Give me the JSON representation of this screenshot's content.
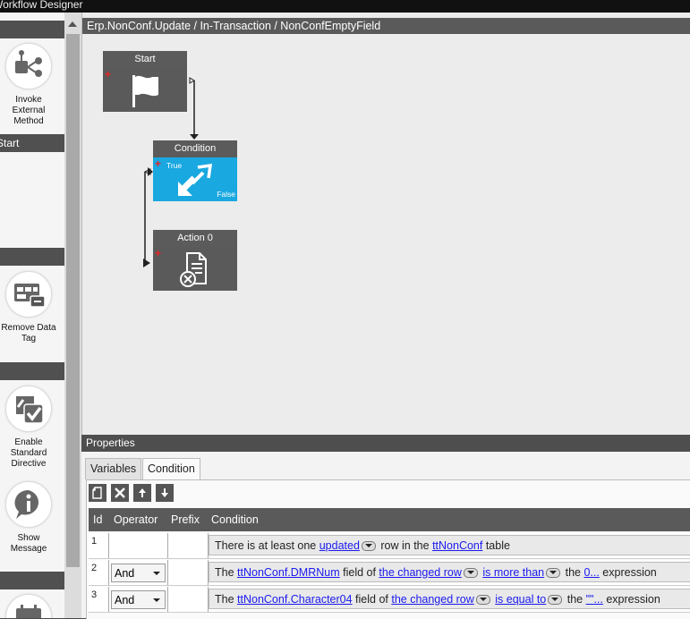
{
  "window": {
    "title": "Workflow Designer"
  },
  "toolbox": {
    "headers": [
      "",
      "Start",
      "",
      ""
    ],
    "items": [
      {
        "label": "Invoke External Method",
        "icon": "invoke-external-method-icon"
      },
      {
        "label": "Remove Data Tag",
        "icon": "remove-data-tag-icon"
      },
      {
        "label": "Enable Standard Directive",
        "icon": "enable-standard-directive-icon"
      },
      {
        "label": "Show Message",
        "icon": "show-message-icon"
      }
    ]
  },
  "designer": {
    "breadcrumb": "Erp.NonConf.Update / In-Transaction / NonConfEmptyField",
    "nodes": [
      {
        "title": "Start",
        "icon": "flag-icon"
      },
      {
        "title": "Condition",
        "icon": "condition-icon",
        "true_label": "True",
        "false_label": "False"
      },
      {
        "title": "Action 0",
        "icon": "action-icon"
      }
    ]
  },
  "properties": {
    "title": "Properties",
    "tabs": [
      {
        "label": "Variables"
      },
      {
        "label": "Condition"
      }
    ],
    "columns": [
      "Id",
      "Operator",
      "Prefix",
      "Condition"
    ],
    "rows": [
      {
        "id": "1",
        "operator": "",
        "parts": [
          "There is at least one ",
          "updated",
          " row in the ",
          "ttNonConf",
          " table"
        ]
      },
      {
        "id": "2",
        "operator": "And",
        "parts": [
          "The ",
          "ttNonConf.DMRNum",
          " field of ",
          "the changed row",
          " ",
          "is more than",
          " the ",
          "0...",
          " expression"
        ]
      },
      {
        "id": "3",
        "operator": "And",
        "parts": [
          "The ",
          "ttNonConf.Character04",
          " field of ",
          "the changed row",
          " ",
          "is equal to",
          " the ",
          "\"\"...",
          " expression"
        ]
      }
    ]
  },
  "colors": {
    "condition_blue": "#19a8e0",
    "node_gray": "#5a5a5a",
    "link_blue": "#1a1aee",
    "plus_red": "#e22222"
  }
}
